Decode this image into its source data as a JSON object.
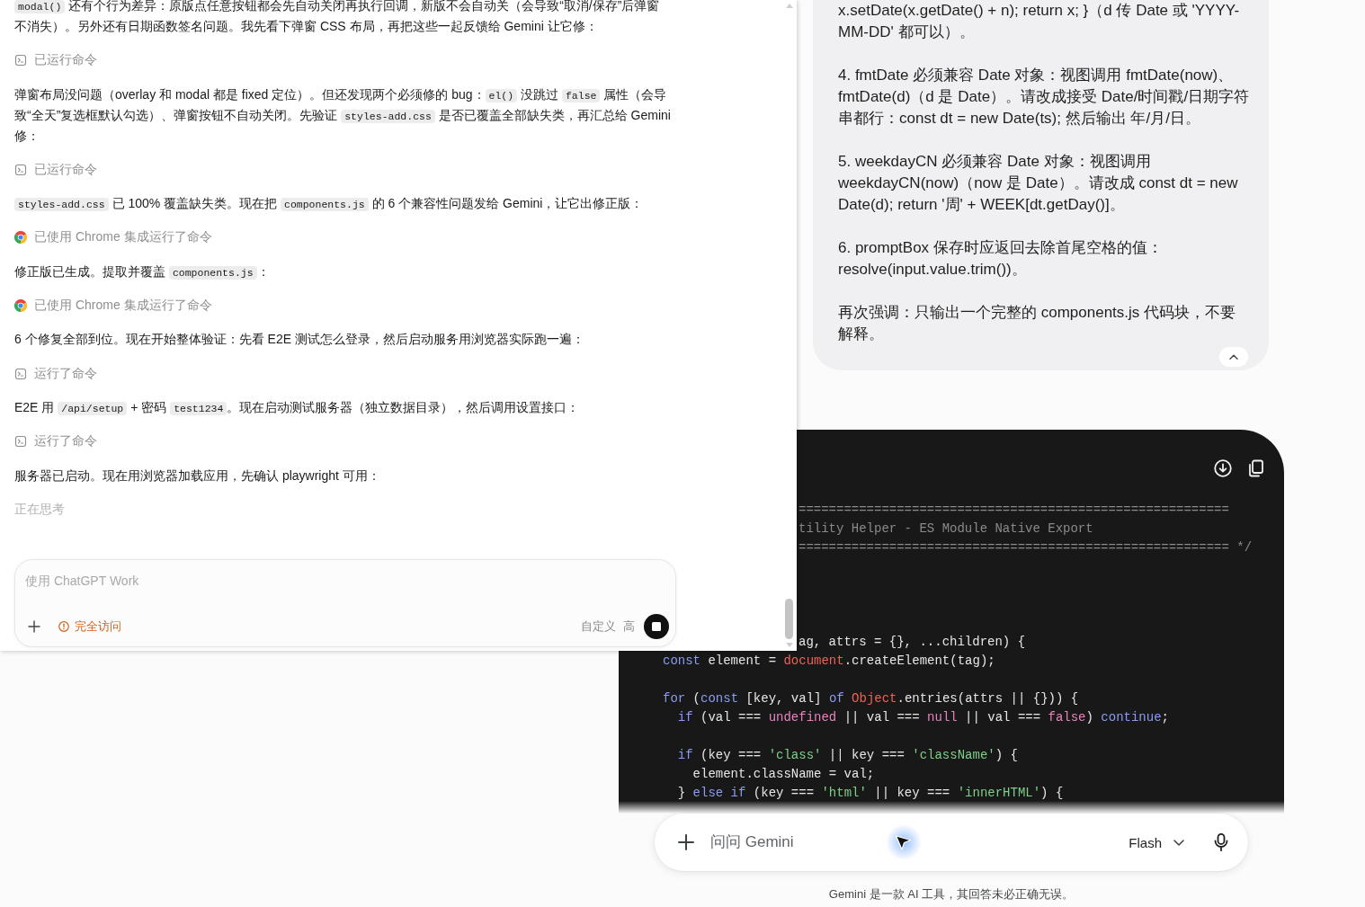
{
  "assistant_panel": {
    "messages": [
      {
        "kind": "text",
        "segments": [
          {
            "kind": "code",
            "text": "modal()"
          },
          {
            "kind": "text",
            "text": " 还有个行为差异：原版点任意按钮都会先自动关闭再执行回调，新版不会自动关（会导致“取消/保存”后弹窗不消失）。另外还有日期函数签名问题。我先看下弹窗 CSS 布局，再把这些一起反馈给 Gemini 让它修："
          }
        ]
      },
      {
        "kind": "terminal",
        "label": "已运行命令"
      },
      {
        "kind": "text",
        "segments": [
          {
            "kind": "text",
            "text": "弹窗布局没问题（overlay 和 modal 都是 fixed 定位）。但还发现两个必须修的 bug："
          },
          {
            "kind": "code",
            "text": "el()"
          },
          {
            "kind": "text",
            "text": " 没跳过 "
          },
          {
            "kind": "code",
            "text": "false"
          },
          {
            "kind": "text",
            "text": " 属性（会导致“全天”复选框默认勾选）、弹窗按钮不自动关闭。先验证 "
          },
          {
            "kind": "code",
            "text": "styles-add.css"
          },
          {
            "kind": "text",
            "text": " 是否已覆盖全部缺失类，再汇总给 Gemini 修："
          }
        ]
      },
      {
        "kind": "terminal",
        "label": "已运行命令"
      },
      {
        "kind": "text",
        "segments": [
          {
            "kind": "code",
            "text": "styles-add.css"
          },
          {
            "kind": "text",
            "text": " 已 100% 覆盖缺失类。现在把 "
          },
          {
            "kind": "code",
            "text": "components.js"
          },
          {
            "kind": "text",
            "text": " 的 6 个兼容性问题发给 Gemini，让它出修正版："
          }
        ]
      },
      {
        "kind": "browser",
        "label": "已使用 Chrome 集成运行了命令"
      },
      {
        "kind": "text",
        "segments": [
          {
            "kind": "text",
            "text": "修正版已生成。提取并覆盖 "
          },
          {
            "kind": "code",
            "text": "components.js"
          },
          {
            "kind": "text",
            "text": "："
          }
        ]
      },
      {
        "kind": "browser",
        "label": "已使用 Chrome 集成运行了命令"
      },
      {
        "kind": "text",
        "segments": [
          {
            "kind": "text",
            "text": "6 个修复全部到位。现在开始整体验证：先看 E2E 测试怎么登录，然后启动服务用浏览器实际跑一遍："
          }
        ]
      },
      {
        "kind": "terminal",
        "label": "运行了命令"
      },
      {
        "kind": "text",
        "segments": [
          {
            "kind": "text",
            "text": "E2E 用 "
          },
          {
            "kind": "code",
            "text": "/api/setup"
          },
          {
            "kind": "text",
            "text": " + 密码 "
          },
          {
            "kind": "code",
            "text": "test1234"
          },
          {
            "kind": "text",
            "text": "。现在启动测试服务器（独立数据目录），然后调用设置接口："
          }
        ]
      },
      {
        "kind": "terminal",
        "label": "运行了命令"
      },
      {
        "kind": "text",
        "segments": [
          {
            "kind": "text",
            "text": "服务器已启动。现在用浏览器加载应用，先确认 playwright 可用："
          }
        ]
      }
    ],
    "status": "正在思考",
    "composer": {
      "placeholder": "使用 ChatGPT Work",
      "access": "完全访问",
      "mode": "自定义",
      "effort": "高"
    }
  },
  "gemini": {
    "user_message": {
      "paragraphs": [
        "x.setDate(x.getDate() + n); return x; }（d 传 Date 或 'YYYY-MM-DD' 都可以）。",
        "4. fmtDate 必须兼容 Date 对象：视图调用 fmtDate(now)、fmtDate(d)（d 是 Date）。请改成接受 Date/时间戳/日期字符串都行：const dt = new Date(ts); 然后输出 年/月/日。",
        "5. weekdayCN 必须兼容 Date 对象：视图调用 weekdayCN(now)（now 是 Date）。请改成 const dt = new Date(d); return '周' + WEEK[dt.getDay()]。",
        "6. promptBox 保存时应返回去除首尾空格的值：resolve(input.value.trim())。",
        "再次强调：只输出一个完整的 components.js 代码块，不要解释。"
      ]
    },
    "code_block": {
      "lines": [
        {
          "kind": "clipped",
          "tokens": [
            {
              "kind": "comment",
              "text": "========================================================="
            }
          ]
        },
        {
          "kind": "clipped",
          "tokens": [
            {
              "kind": "comment",
              "text": "tility Helper - ES Module Native Export"
            }
          ]
        },
        {
          "kind": "clipped",
          "tokens": [
            {
              "kind": "comment",
              "text": "========================================================= */"
            }
          ]
        },
        {
          "kind": "blank"
        },
        {
          "kind": "blank"
        },
        {
          "kind": "blank"
        },
        {
          "kind": "blank"
        },
        {
          "kind": "clipped",
          "tokens": [
            {
              "kind": "plain",
              "text": "ag, attrs = {}, ...children) {"
            }
          ]
        },
        {
          "kind": "code",
          "tokens": [
            {
              "kind": "keyword",
              "text": "const"
            },
            {
              "kind": "plain",
              "text": " element = "
            },
            {
              "kind": "builtin",
              "text": "document"
            },
            {
              "kind": "plain",
              "text": ".createElement(tag);"
            }
          ]
        },
        {
          "kind": "blank"
        },
        {
          "kind": "code",
          "tokens": [
            {
              "kind": "keyword",
              "text": "for"
            },
            {
              "kind": "plain",
              "text": " ("
            },
            {
              "kind": "keyword",
              "text": "const"
            },
            {
              "kind": "plain",
              "text": " [key, val] "
            },
            {
              "kind": "keyword",
              "text": "of "
            },
            {
              "kind": "builtin",
              "text": "Object"
            },
            {
              "kind": "plain",
              "text": ".entries(attrs || {})) {"
            }
          ]
        },
        {
          "kind": "code",
          "tokens": [
            {
              "kind": "keyword",
              "text": "  if"
            },
            {
              "kind": "plain",
              "text": " (val === "
            },
            {
              "kind": "literal",
              "text": "undefined"
            },
            {
              "kind": "plain",
              "text": " || val === "
            },
            {
              "kind": "literal",
              "text": "null"
            },
            {
              "kind": "plain",
              "text": " || val === "
            },
            {
              "kind": "literal",
              "text": "false"
            },
            {
              "kind": "plain",
              "text": ") "
            },
            {
              "kind": "keyword",
              "text": "continue"
            },
            {
              "kind": "plain",
              "text": ";"
            }
          ]
        },
        {
          "kind": "blank"
        },
        {
          "kind": "code",
          "tokens": [
            {
              "kind": "keyword",
              "text": "  if"
            },
            {
              "kind": "plain",
              "text": " (key === "
            },
            {
              "kind": "string",
              "text": "'class'"
            },
            {
              "kind": "plain",
              "text": " || key === "
            },
            {
              "kind": "string",
              "text": "'className'"
            },
            {
              "kind": "plain",
              "text": ") {"
            }
          ]
        },
        {
          "kind": "code",
          "tokens": [
            {
              "kind": "plain",
              "text": "    element.className = val;"
            }
          ]
        },
        {
          "kind": "code",
          "tokens": [
            {
              "kind": "plain",
              "text": "  } "
            },
            {
              "kind": "keyword",
              "text": "else if"
            },
            {
              "kind": "plain",
              "text": " (key === "
            },
            {
              "kind": "string",
              "text": "'html'"
            },
            {
              "kind": "plain",
              "text": " || key === "
            },
            {
              "kind": "string",
              "text": "'innerHTML'"
            },
            {
              "kind": "plain",
              "text": ") {"
            }
          ]
        }
      ]
    },
    "prompt": {
      "placeholder": "问问 Gemini",
      "model": "Flash"
    },
    "disclaimer": "Gemini 是一款 AI 工具，其回答未必正确无误。"
  }
}
